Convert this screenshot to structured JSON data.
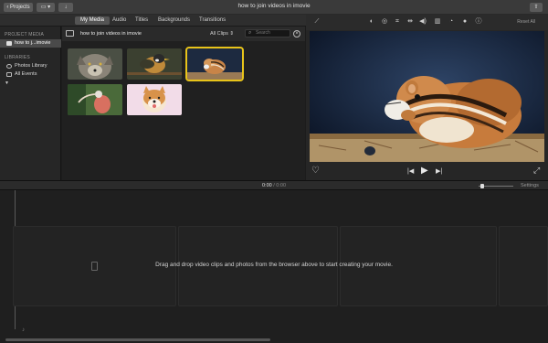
{
  "window": {
    "title": "how to join videos in imovie",
    "projects_button": "Projects"
  },
  "tabs": [
    {
      "label": "My Media"
    },
    {
      "label": "Audio"
    },
    {
      "label": "Titles"
    },
    {
      "label": "Backgrounds"
    },
    {
      "label": "Transitions"
    }
  ],
  "sidebar": {
    "project_media_heading": "PROJECT MEDIA",
    "project_item": "how to j...imovie",
    "libraries_heading": "LIBRARIES",
    "libraries": [
      {
        "label": "Photos Library"
      },
      {
        "label": "All Events"
      }
    ]
  },
  "browser": {
    "title": "how to join videos in imovie",
    "filter": "All Clips",
    "search_placeholder": "Search",
    "thumbnails": [
      {
        "subject": "wolf"
      },
      {
        "subject": "bird"
      },
      {
        "subject": "chipmunk",
        "selected": true
      },
      {
        "subject": "ibis"
      },
      {
        "subject": "dog"
      }
    ]
  },
  "viewer": {
    "reset_all": "Reset All",
    "subject": "chipmunk"
  },
  "timeline": {
    "current_time": "0:00",
    "total_time": "0:00",
    "settings_label": "Settings",
    "empty_message": "Drag and drop video clips and photos from the browser above to start creating your movie."
  },
  "colors": {
    "selection": "#e8c41a",
    "active_tab": "#545454",
    "background": "#1c1c1c"
  }
}
